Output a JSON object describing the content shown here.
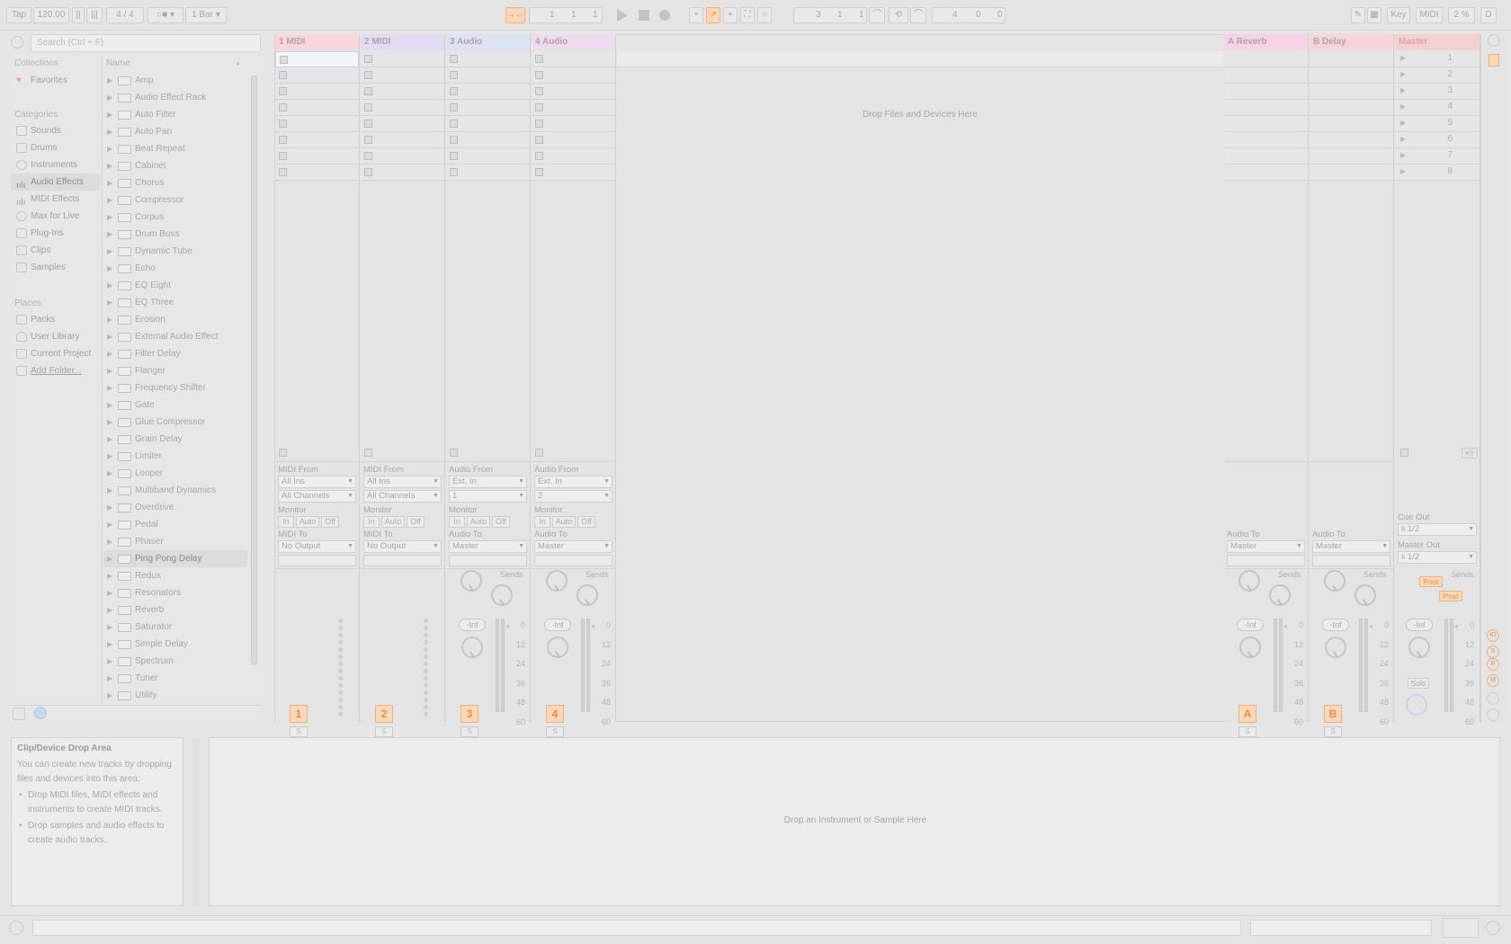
{
  "transport": {
    "tap": "Tap",
    "tempo": "120.00",
    "signature": "4 / 4",
    "metronome": "1 Bar",
    "pos1": "1",
    "pos2": "1",
    "pos3": "1",
    "loop1": "3",
    "loop2": "1",
    "loop3": "1",
    "len1": "4",
    "len2": "0",
    "len3": "0",
    "key": "Key",
    "midi": "MIDI",
    "cpu": "2 %",
    "d": "D"
  },
  "browser": {
    "search_placeholder": "Search (Ctrl + F)",
    "collections_header": "Collections",
    "favorites": "Favorites",
    "categories_header": "Categories",
    "categories": [
      "Sounds",
      "Drums",
      "Instruments",
      "Audio Effects",
      "MIDI Effects",
      "Max for Live",
      "Plug-Ins",
      "Clips",
      "Samples"
    ],
    "places_header": "Places",
    "places": [
      "Packs",
      "User Library",
      "Current Project",
      "Add Folder..."
    ],
    "name_header": "Name",
    "items": [
      "Amp",
      "Audio Effect Rack",
      "Auto Filter",
      "Auto Pan",
      "Beat Repeat",
      "Cabinet",
      "Chorus",
      "Compressor",
      "Corpus",
      "Drum Buss",
      "Dynamic Tube",
      "Echo",
      "EQ Eight",
      "EQ Three",
      "Erosion",
      "External Audio Effect",
      "Filter Delay",
      "Flanger",
      "Frequency Shifter",
      "Gate",
      "Glue Compressor",
      "Grain Delay",
      "Limiter",
      "Looper",
      "Multiband Dynamics",
      "Overdrive",
      "Pedal",
      "Phaser",
      "Ping Pong Delay",
      "Redux",
      "Resonators",
      "Reverb",
      "Saturator",
      "Simple Delay",
      "Spectrum",
      "Tuner",
      "Utility"
    ]
  },
  "tracks": [
    {
      "name": "1 MIDI",
      "color": "#f7d7dd",
      "from_label": "MIDI From",
      "from": "All Ins",
      "channel": "All Channels",
      "to_label": "MIDI To",
      "to": "No Output",
      "num": "1",
      "type": "midi"
    },
    {
      "name": "2 MIDI",
      "color": "#e2dcf2",
      "from_label": "MIDI From",
      "from": "All Ins",
      "channel": "All Channels",
      "to_label": "MIDI To",
      "to": "No Output",
      "num": "2",
      "type": "midi"
    },
    {
      "name": "3 Audio",
      "color": "#dce4f4",
      "from_label": "Audio From",
      "from": "Ext. In",
      "channel": "1",
      "to_label": "Audio To",
      "to": "Master",
      "num": "3",
      "type": "audio"
    },
    {
      "name": "4 Audio",
      "color": "#ecdcee",
      "from_label": "Audio From",
      "from": "Ext. In",
      "channel": "2",
      "to_label": "Audio To",
      "to": "Master",
      "num": "4",
      "type": "audio"
    }
  ],
  "returns": [
    {
      "name": "A Reverb",
      "color": "#f7d3e4",
      "to_label": "Audio To",
      "to": "Master",
      "num": "A"
    },
    {
      "name": "B Delay",
      "color": "#f7d3dc",
      "to_label": "Audio To",
      "to": "Master",
      "num": "B"
    }
  ],
  "master": {
    "name": "Master",
    "color": "#f4d0d0",
    "cue_label": "Cue Out",
    "cue": "ii 1/2",
    "out_label": "Master Out",
    "out": "ii 1/2",
    "scenes": [
      "1",
      "2",
      "3",
      "4",
      "5",
      "6",
      "7",
      "8"
    ],
    "solo": "Solo",
    "post": "Post"
  },
  "monitor": {
    "label": "Monitor",
    "in": "In",
    "auto": "Auto",
    "off": "Off"
  },
  "mixer": {
    "sends": "Sends",
    "vol": "-Inf",
    "scale": [
      "0",
      "12",
      "24",
      "36",
      "48",
      "60"
    ],
    "s": "S",
    "zero": "0"
  },
  "drop_hint": "Drop Files and Devices Here",
  "info": {
    "title": "Clip/Device Drop Area",
    "body": "You can create new tracks by dropping files and devices into this area:",
    "bullet1": "Drop MIDI files, MIDI effects and instruments to create MIDI tracks.",
    "bullet2": "Drop samples and audio effects to create audio tracks."
  },
  "detail_hint": "Drop an Instrument or Sample Here"
}
